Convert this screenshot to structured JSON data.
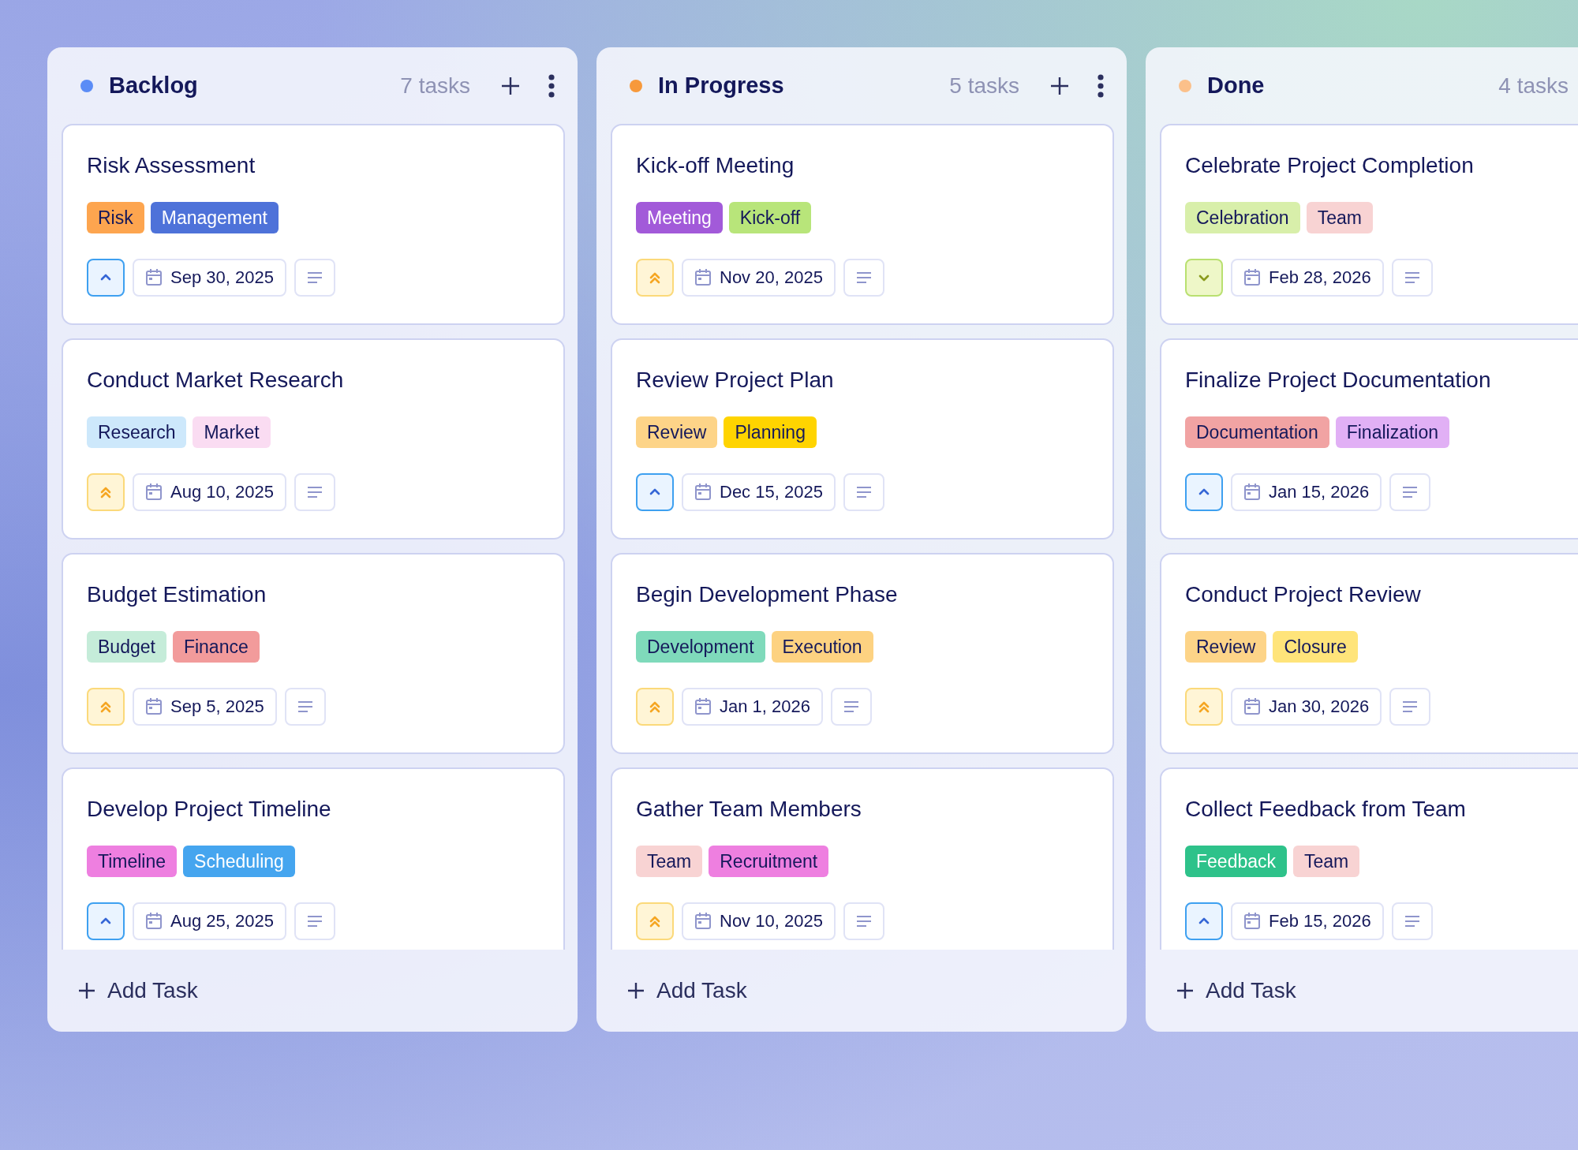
{
  "columns": [
    {
      "title": "Backlog",
      "color": "#5b8cf6",
      "count": "7 tasks",
      "add_label": "Add Task",
      "cards": [
        {
          "title": "Risk Assessment",
          "tags": [
            {
              "label": "Risk",
              "color": "#fda54f"
            },
            {
              "label": "Management",
              "color": "#4e72d9"
            }
          ],
          "priority": {
            "kind": "medium"
          },
          "date": "Sep 30, 2025"
        },
        {
          "title": "Conduct Market Research",
          "tags": [
            {
              "label": "Research",
              "color": "#cde8fb"
            },
            {
              "label": "Market",
              "color": "#fadcf2"
            }
          ],
          "priority": {
            "kind": "high"
          },
          "date": "Aug 10, 2025"
        },
        {
          "title": "Budget Estimation",
          "tags": [
            {
              "label": "Budget",
              "color": "#c5ecd9"
            },
            {
              "label": "Finance",
              "color": "#f29b9b"
            }
          ],
          "priority": {
            "kind": "high"
          },
          "date": "Sep 5, 2025"
        },
        {
          "title": "Develop Project Timeline",
          "tags": [
            {
              "label": "Timeline",
              "color": "#ee7fe0"
            },
            {
              "label": "Scheduling",
              "color": "#45a5ef"
            }
          ],
          "priority": {
            "kind": "medium"
          },
          "date": "Aug 25, 2025"
        }
      ]
    },
    {
      "title": "In Progress",
      "color": "#f7993b",
      "count": "5 tasks",
      "add_label": "Add Task",
      "cards": [
        {
          "title": "Kick-off Meeting",
          "tags": [
            {
              "label": "Meeting",
              "color": "#a25ad9"
            },
            {
              "label": "Kick-off",
              "color": "#b8e57a"
            }
          ],
          "priority": {
            "kind": "high"
          },
          "date": "Nov 20, 2025"
        },
        {
          "title": "Review Project Plan",
          "tags": [
            {
              "label": "Review",
              "color": "#fdd488"
            },
            {
              "label": "Planning",
              "color": "#ffd400"
            }
          ],
          "priority": {
            "kind": "medium"
          },
          "date": "Dec 15, 2025"
        },
        {
          "title": "Begin Development Phase",
          "tags": [
            {
              "label": "Development",
              "color": "#7fdabb"
            },
            {
              "label": "Execution",
              "color": "#fdd281"
            }
          ],
          "priority": {
            "kind": "high"
          },
          "date": "Jan 1, 2026"
        },
        {
          "title": "Gather Team Members",
          "tags": [
            {
              "label": "Team",
              "color": "#f8d3d3"
            },
            {
              "label": "Recruitment",
              "color": "#ee7fe0"
            }
          ],
          "priority": {
            "kind": "high"
          },
          "date": "Nov 10, 2025"
        }
      ]
    },
    {
      "title": "Done",
      "color": "#fbc08a",
      "count": "4 tasks",
      "add_label": "Add Task",
      "cards": [
        {
          "title": "Celebrate Project Completion",
          "tags": [
            {
              "label": "Celebration",
              "color": "#d8efaa"
            },
            {
              "label": "Team",
              "color": "#f8d3d3"
            }
          ],
          "priority": {
            "kind": "low"
          },
          "date": "Feb 28, 2026"
        },
        {
          "title": "Finalize Project Documentation",
          "tags": [
            {
              "label": "Documentation",
              "color": "#f1a3a3"
            },
            {
              "label": "Finalization",
              "color": "#e1b0f5"
            }
          ],
          "priority": {
            "kind": "medium"
          },
          "date": "Jan 15, 2026"
        },
        {
          "title": "Conduct Project Review",
          "tags": [
            {
              "label": "Review",
              "color": "#fdd488"
            },
            {
              "label": "Closure",
              "color": "#ffe47a"
            }
          ],
          "priority": {
            "kind": "high"
          },
          "date": "Jan 30, 2026"
        },
        {
          "title": "Collect Feedback from Team",
          "tags": [
            {
              "label": "Feedback",
              "color": "#2ec28a"
            },
            {
              "label": "Team",
              "color": "#f8d3d3"
            }
          ],
          "priority": {
            "kind": "medium"
          },
          "date": "Feb 15, 2026"
        }
      ]
    }
  ]
}
